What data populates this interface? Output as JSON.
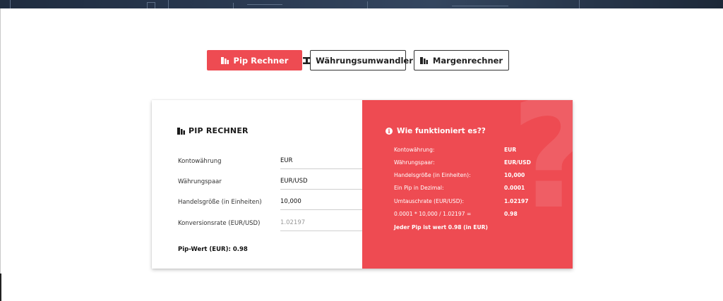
{
  "tabs": [
    {
      "label": "Pip Rechner",
      "icon": "calculator-icon",
      "active": true
    },
    {
      "label": "Währungsumwandler",
      "icon": "exchange-icon",
      "active": false
    },
    {
      "label": "Margenrechner",
      "icon": "calculator-icon",
      "active": false
    }
  ],
  "calculator": {
    "title": "PIP RECHNER",
    "fields": [
      {
        "label": "Kontowährung",
        "value": "EUR"
      },
      {
        "label": "Währungspaar",
        "value": "EUR/USD"
      },
      {
        "label": "Handelsgröße (in Einheiten)",
        "value": "10,000"
      },
      {
        "label": "Konversionsrate (EUR/USD)",
        "value": "1.02197"
      }
    ],
    "result_label": "Pip-Wert (EUR):",
    "result_value": "0.98"
  },
  "info": {
    "title": "Wie funktioniert es??",
    "rows": [
      {
        "label": "Kontowährung:",
        "value": "EUR"
      },
      {
        "label": "Währungspaar:",
        "value": "EUR/USD"
      },
      {
        "label": "Handelsgröße (in Einheiten):",
        "value": "10,000"
      },
      {
        "label": "Ein Pip in Dezimal:",
        "value": "0.0001"
      },
      {
        "label": "Umtauschrate (EUR/USD):",
        "value": "1.02197"
      },
      {
        "label": "0.0001 * 10,000 / 1.02197 =",
        "value": "0.98"
      }
    ],
    "summary": "Jeder Pip ist wert 0.98 (in EUR)",
    "decoration": "?"
  },
  "colors": {
    "accent": "#ee4b52",
    "text": "#222222",
    "header_strip": "#2a3a52"
  }
}
